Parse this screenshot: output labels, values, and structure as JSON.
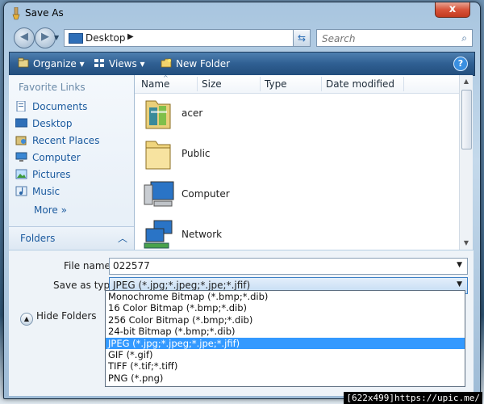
{
  "window": {
    "title": "Save As",
    "close_label": "x"
  },
  "address_bar": {
    "location": "Desktop",
    "search_placeholder": "Search"
  },
  "toolbar": {
    "organize": "Organize",
    "views": "Views",
    "new_folder": "New Folder",
    "help": "?"
  },
  "nav_pane": {
    "heading": "Favorite Links",
    "items": [
      {
        "label": "Documents",
        "icon": "documents-icon"
      },
      {
        "label": "Desktop",
        "icon": "desktop-icon"
      },
      {
        "label": "Recent Places",
        "icon": "recent-places-icon"
      },
      {
        "label": "Computer",
        "icon": "computer-icon"
      },
      {
        "label": "Pictures",
        "icon": "pictures-icon"
      },
      {
        "label": "Music",
        "icon": "music-icon"
      }
    ],
    "more": "More",
    "folders": "Folders"
  },
  "file_list": {
    "columns": [
      "Name",
      "Size",
      "Type",
      "Date modified"
    ],
    "files": [
      {
        "name": "acer",
        "icon": "user-folder-icon"
      },
      {
        "name": "Public",
        "icon": "folder-icon"
      },
      {
        "name": "Computer",
        "icon": "computer-icon"
      },
      {
        "name": "Network",
        "icon": "network-icon"
      }
    ]
  },
  "form": {
    "file_name_label": "File name:",
    "file_name_value": "022577",
    "save_type_label": "Save as type:",
    "save_type_value": "JPEG (*.jpg;*.jpeg;*.jpe;*.jfif)",
    "hide_folders": "Hide Folders",
    "type_options": [
      "Monochrome Bitmap (*.bmp;*.dib)",
      "16 Color Bitmap (*.bmp;*.dib)",
      "256 Color Bitmap (*.bmp;*.dib)",
      "24-bit Bitmap (*.bmp;*.dib)",
      "JPEG (*.jpg;*.jpeg;*.jpe;*.jfif)",
      "GIF (*.gif)",
      "TIFF (*.tif;*.tiff)",
      "PNG (*.png)"
    ],
    "selected_index": 4
  },
  "watermark": "[622x499]https://upic.me/"
}
